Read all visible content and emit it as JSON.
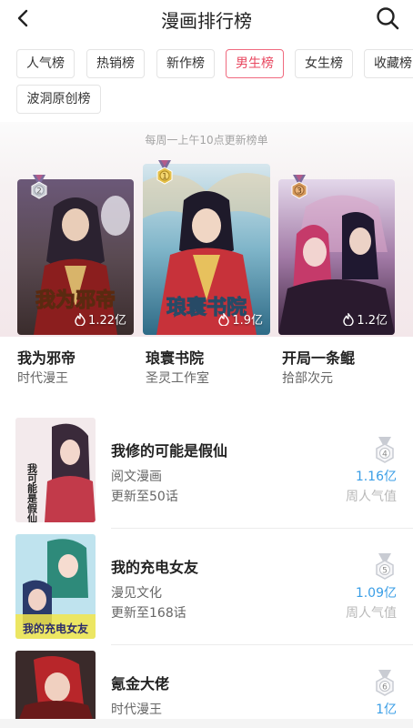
{
  "header": {
    "title": "漫画排行榜"
  },
  "tabs": [
    {
      "label": "人气榜",
      "active": false
    },
    {
      "label": "热销榜",
      "active": false
    },
    {
      "label": "新作榜",
      "active": false
    },
    {
      "label": "男生榜",
      "active": true
    },
    {
      "label": "女生榜",
      "active": false
    },
    {
      "label": "收藏榜",
      "active": false
    },
    {
      "label": "波洞原创榜",
      "active": false
    }
  ],
  "notice": "每周一上午10点更新榜单",
  "top": [
    {
      "rank": "2",
      "title": "我为邪帝",
      "author": "时代漫王",
      "heat": "1.22亿",
      "cover_text": "我为邪帝"
    },
    {
      "rank": "1",
      "title": "琅寰书院",
      "author": "圣灵工作室",
      "heat": "1.9亿",
      "cover_text": "琅寰书院"
    },
    {
      "rank": "3",
      "title": "开局一条鲲",
      "author": "拾部次元",
      "heat": "1.2亿",
      "cover_text": ""
    }
  ],
  "list": [
    {
      "rank": "4",
      "title": "我修的可能是假仙",
      "publisher": "阅文漫画",
      "update": "更新至50话",
      "value": "1.16亿",
      "value_label": "周人气值",
      "cover_text": "我可能是假仙"
    },
    {
      "rank": "5",
      "title": "我的充电女友",
      "publisher": "漫见文化",
      "update": "更新至168话",
      "value": "1.09亿",
      "value_label": "周人气值",
      "cover_text": "我的充电女友"
    },
    {
      "rank": "6",
      "title": "氪金大佬",
      "publisher": "时代漫王",
      "update": "",
      "value": "1亿",
      "value_label": "",
      "cover_text": ""
    }
  ],
  "colors": {
    "accent": "#e8475f",
    "value_blue": "#3a9ee6",
    "gold": "#e0b83a",
    "silver": "#b8bcc4",
    "bronze": "#d69a5c"
  },
  "icons": {
    "back": "chevron-left-icon",
    "search": "search-icon",
    "heat": "flame-icon",
    "medal": "medal-icon"
  }
}
